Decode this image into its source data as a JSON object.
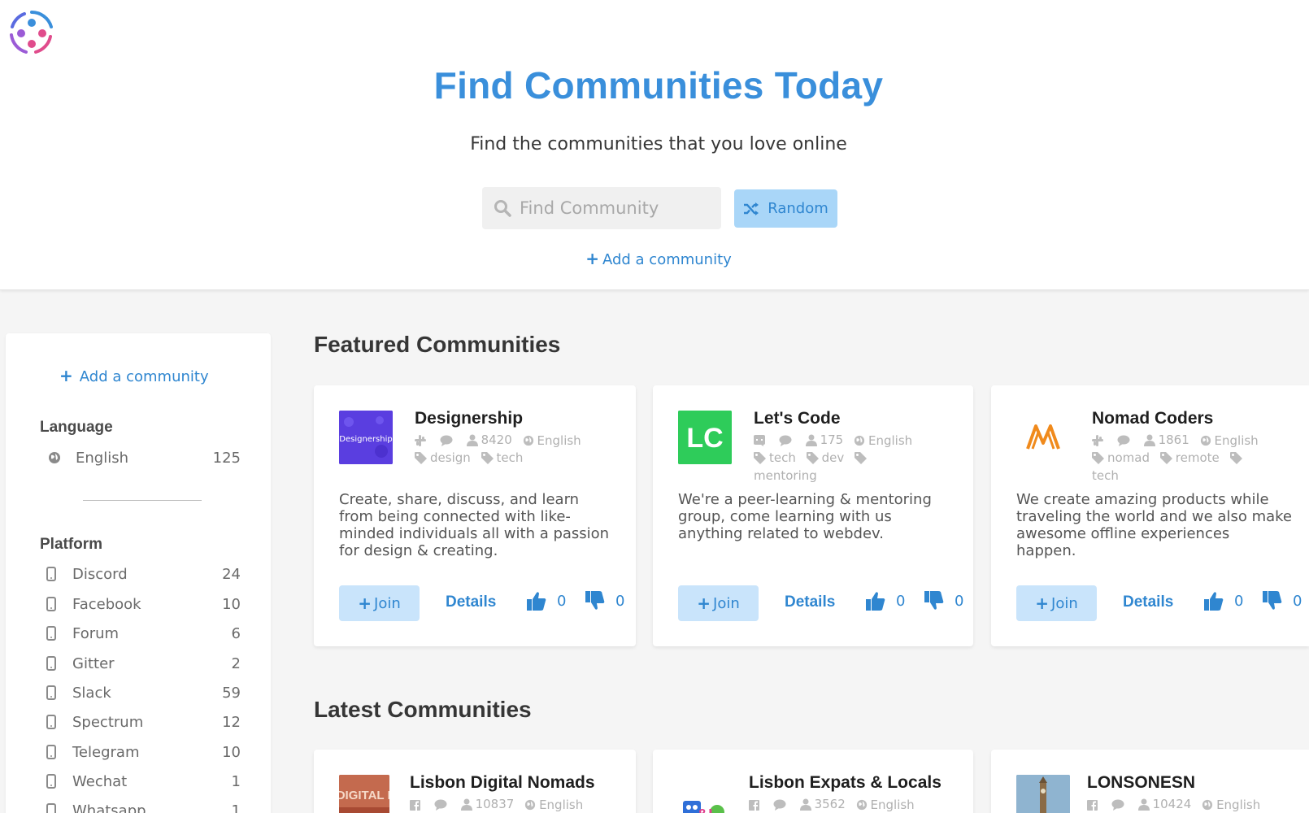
{
  "hero": {
    "title": "Find Communities Today",
    "subtitle": "Find the communities that you love online",
    "search_placeholder": "Find Community",
    "random_label": "Random",
    "add_label": "Add a community"
  },
  "sidebar": {
    "add_label": "Add a community",
    "language_heading": "Language",
    "languages": [
      {
        "label": "English",
        "count": "125"
      }
    ],
    "platform_heading": "Platform",
    "platforms": [
      {
        "label": "Discord",
        "count": "24"
      },
      {
        "label": "Facebook",
        "count": "10"
      },
      {
        "label": "Forum",
        "count": "6"
      },
      {
        "label": "Gitter",
        "count": "2"
      },
      {
        "label": "Slack",
        "count": "59"
      },
      {
        "label": "Spectrum",
        "count": "12"
      },
      {
        "label": "Telegram",
        "count": "10"
      },
      {
        "label": "Wechat",
        "count": "1"
      },
      {
        "label": "Whatsapp",
        "count": "1"
      }
    ]
  },
  "featured": {
    "heading": "Featured Communities",
    "cards": [
      {
        "name": "Designership",
        "platform_icon": "slack-icon",
        "members": "8420",
        "language": "English",
        "tags": [
          "design",
          "tech"
        ],
        "description": "Create, share, discuss, and learn from being connected with like-minded individuals all with a passion for design & creating.",
        "join_label": "Join",
        "details_label": "Details",
        "upvotes": "0",
        "downvotes": "0",
        "logo_text": "Designership",
        "logo_color": "#5a3ee0"
      },
      {
        "name": "Let's Code",
        "platform_icon": "discord-icon",
        "members": "175",
        "language": "English",
        "tags": [
          "tech",
          "dev",
          "mentoring"
        ],
        "description": "We're a peer-learning & mentoring group, come learning with us anything related to webdev.",
        "join_label": "Join",
        "details_label": "Details",
        "upvotes": "0",
        "downvotes": "0",
        "logo_text": "LC",
        "logo_color": "#2ecc5a"
      },
      {
        "name": "Nomad Coders",
        "platform_icon": "slack-icon",
        "members": "1861",
        "language": "English",
        "tags": [
          "nomad",
          "remote",
          "tech"
        ],
        "description": "We create amazing products while traveling the world and we also make awesome offline experiences happen.",
        "join_label": "Join",
        "details_label": "Details",
        "upvotes": "0",
        "downvotes": "0",
        "logo_color": "#f08a1c"
      }
    ]
  },
  "latest": {
    "heading": "Latest Communities",
    "cards": [
      {
        "name": "Lisbon Digital Nomads",
        "platform_icon": "facebook-icon",
        "members": "10837",
        "language": "English",
        "logo_text": "LISBON\nDIGITAL NOMADS"
      },
      {
        "name": "Lisbon Expats & Locals",
        "platform_icon": "facebook-icon",
        "members": "3562",
        "language": "English",
        "logo_text": "&L"
      },
      {
        "name": "LONSONESN",
        "platform_icon": "facebook-icon",
        "members": "10424",
        "language": "English"
      }
    ]
  },
  "colors": {
    "accent": "#2f86d0",
    "title_blue": "#3a8fdb",
    "button_light": "#c9e4fb"
  }
}
